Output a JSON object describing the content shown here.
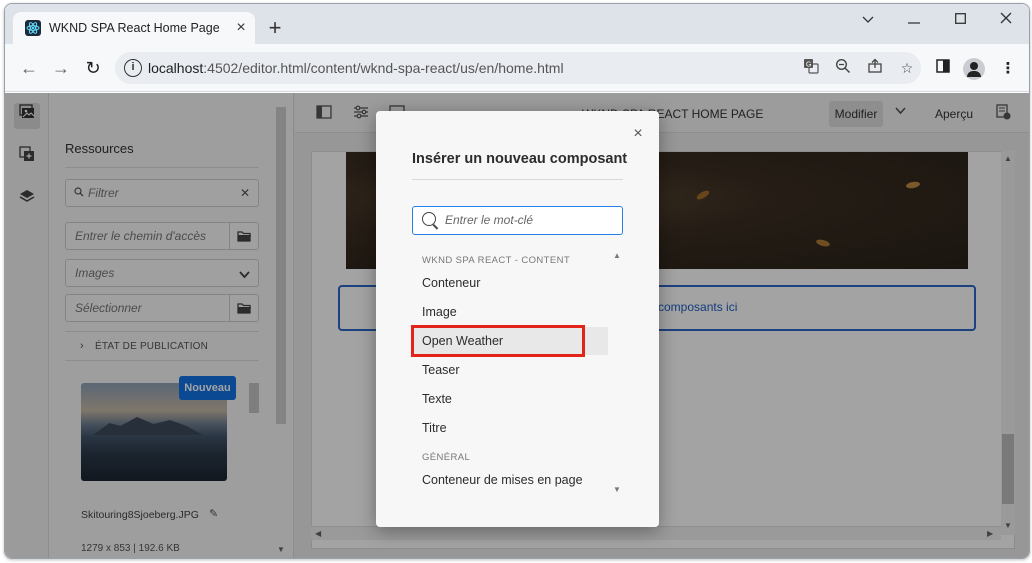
{
  "browser": {
    "tab_title": "WKND SPA React Home Page",
    "tab_close": "×",
    "new_tab": "+",
    "window_controls": {
      "minimize": "⌄",
      "restore": "—",
      "maximize": "☐",
      "close": "✕"
    },
    "nav": {
      "back": "←",
      "forward": "→",
      "reload": "↻"
    },
    "url_host": "localhost",
    "url_rest": ":4502/editor.html/content/wknd-spa-react/us/en/home.html",
    "icons": [
      "translate-icon",
      "zoom-icon",
      "share-icon",
      "bookmark-star-icon",
      "side-panel-icon",
      "profile-icon",
      "menu-icon"
    ]
  },
  "sidebar": {
    "title": "Ressources",
    "filter_placeholder": "Filtrer",
    "path_placeholder": "Entrer le chemin d'accès",
    "type_select": "Images",
    "select_placeholder": "Sélectionner",
    "publication_state": "ÉTAT DE PUBLICATION",
    "asset": {
      "badge": "Nouveau",
      "name": "Skitouring8Sjoeberg.JPG",
      "meta": "1279 x 853 | 192.6 KB"
    }
  },
  "editor": {
    "page_title": "WKND SPA REACT HOME PAGE",
    "mode": "Modifier",
    "preview": "Aperçu",
    "drop_zone_text": "composants ici"
  },
  "modal": {
    "title": "Insérer un nouveau composant",
    "close": "×",
    "search_placeholder": "Entrer le mot-clé",
    "groups": [
      {
        "name": "WKND SPA REACT - CONTENT",
        "items": [
          "Conteneur",
          "Image",
          "Open Weather",
          "Teaser",
          "Texte",
          "Titre"
        ]
      },
      {
        "name": "GÉNÉRAL",
        "items": [
          "Conteneur de mises en page"
        ]
      }
    ],
    "highlighted_item": "Open Weather"
  },
  "colors": {
    "accent_blue": "#2680eb",
    "highlight_red": "#e3241b",
    "badge_blue": "#1473e6"
  }
}
